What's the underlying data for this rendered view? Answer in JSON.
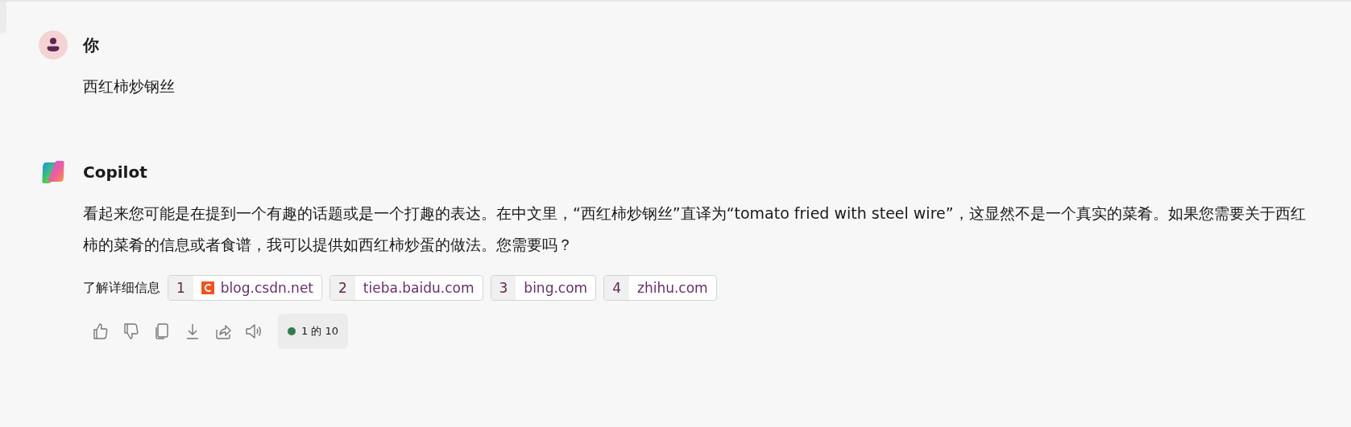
{
  "messages": [
    {
      "author": "你",
      "kind": "user",
      "text": "西红柿炒钢丝"
    },
    {
      "author": "Copilot",
      "kind": "assistant",
      "text": "看起来您可能是在提到一个有趣的话题或是一个打趣的表达。在中文里，“西红柿炒钢丝”直译为“tomato fried with steel wire”，这显然不是一个真实的菜肴。如果您需要关于西红柿的菜肴的信息或者食谱，我可以提供如西红柿炒蛋的做法。您需要吗？",
      "sources_label": "了解详细信息",
      "sources": [
        {
          "number": "1",
          "domain": "blog.csdn.net",
          "favicon": true
        },
        {
          "number": "2",
          "domain": "tieba.baidu.com",
          "favicon": false
        },
        {
          "number": "3",
          "domain": "bing.com",
          "favicon": false
        },
        {
          "number": "4",
          "domain": "zhihu.com",
          "favicon": false
        }
      ],
      "counter": "1 的 10"
    }
  ]
}
